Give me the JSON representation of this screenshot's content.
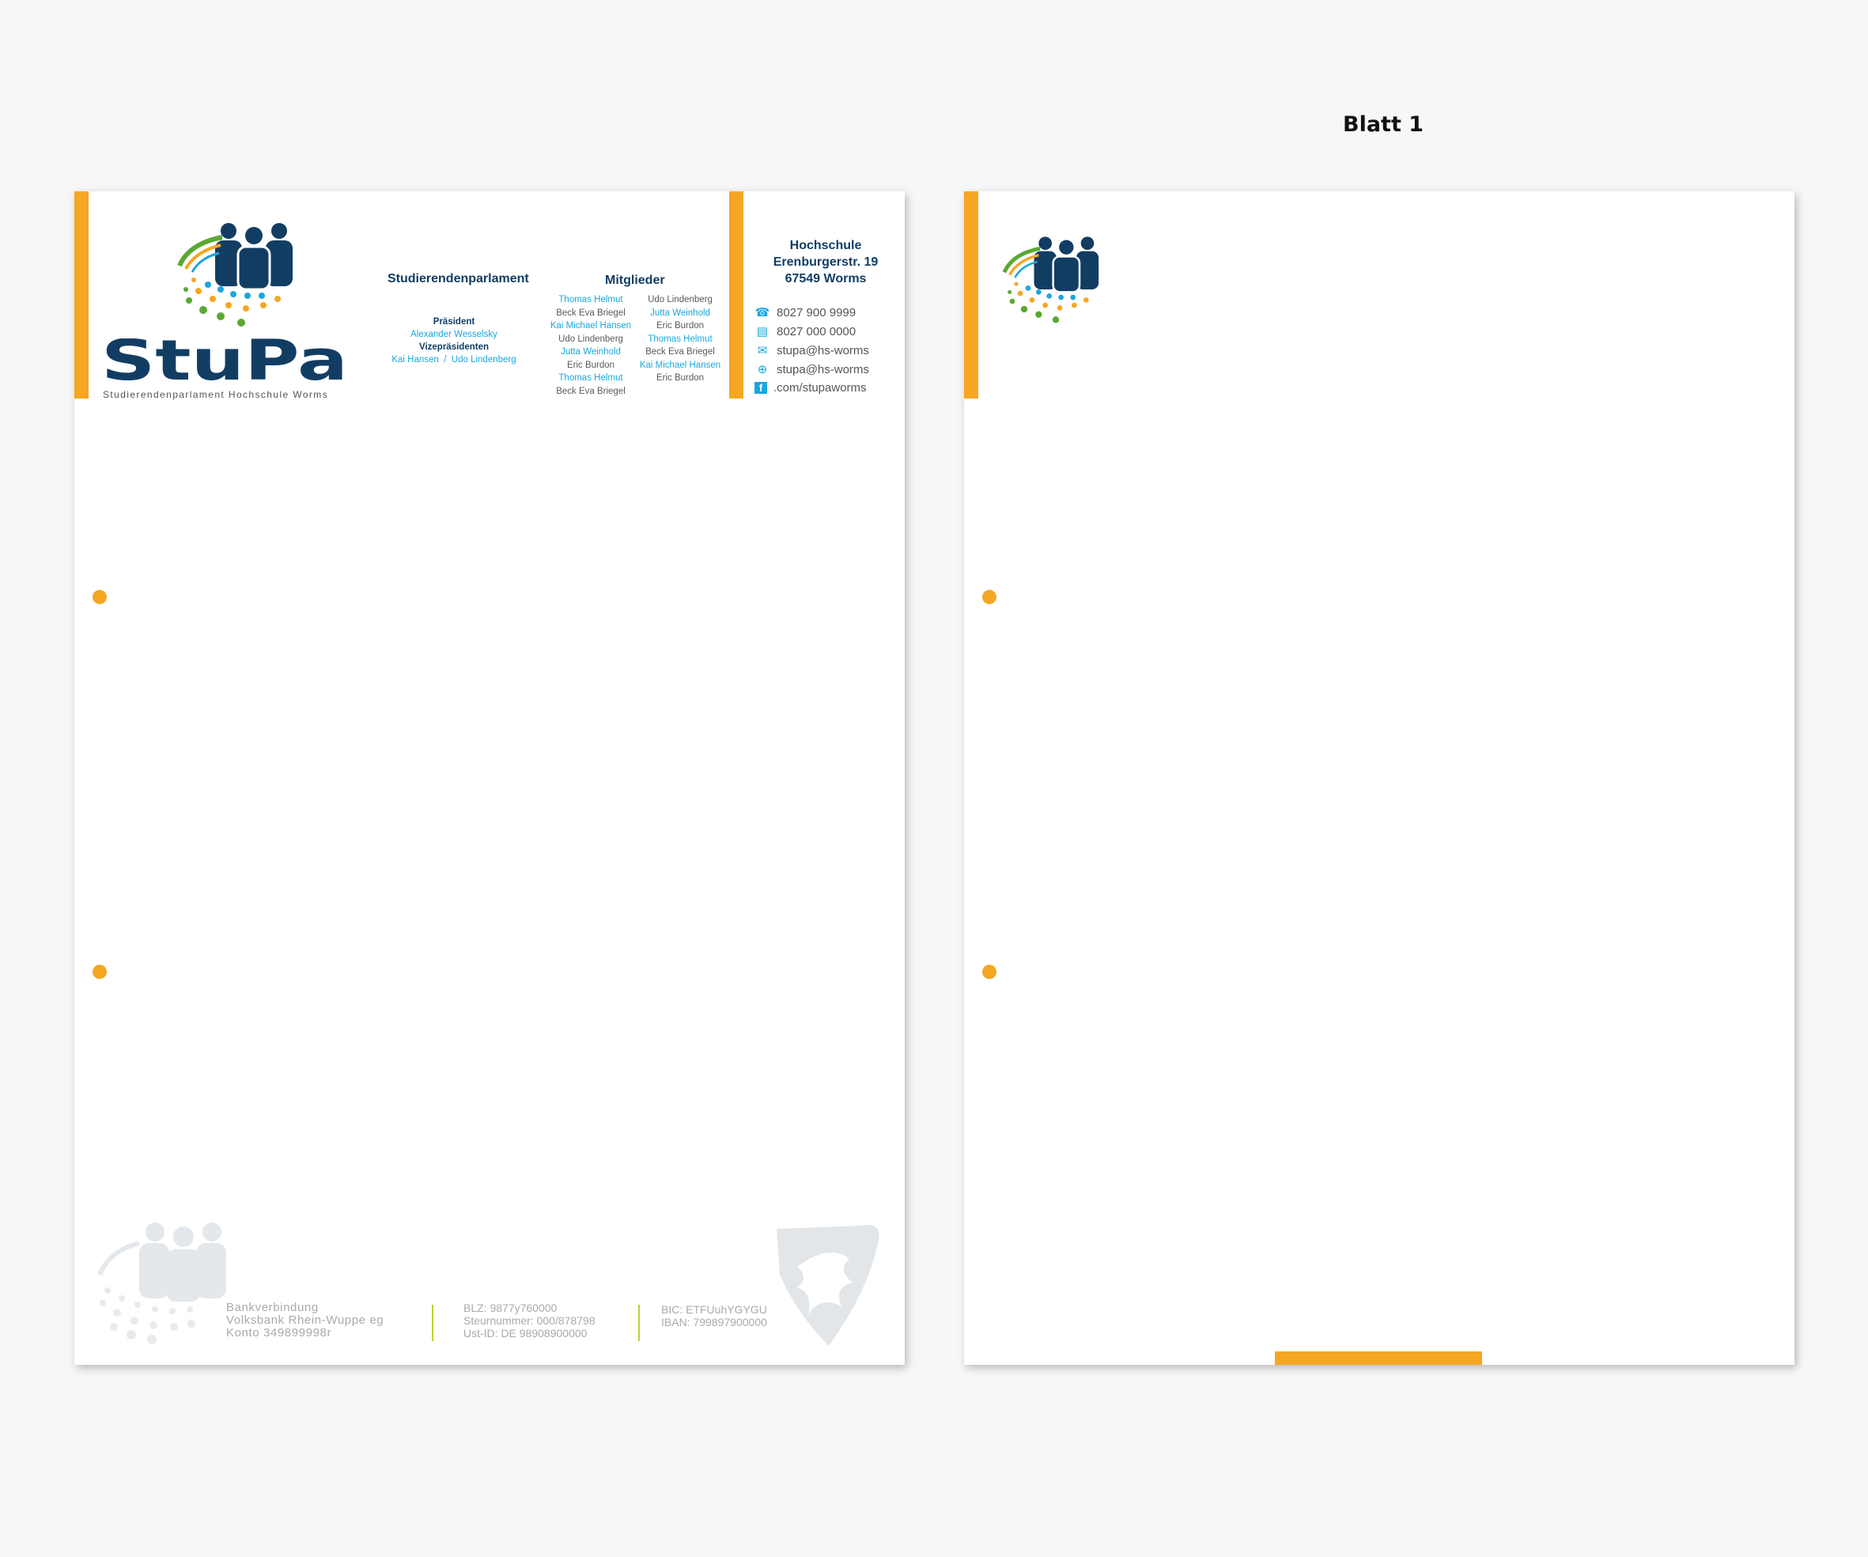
{
  "page_label": "Blatt  1",
  "letterhead": {
    "logo_word": "StuPa",
    "logo_tagline": "Studierendenparlament Hochschule Worms",
    "parliament": {
      "title": "Studierendenparlament",
      "president_label": "Präsident",
      "president_name": "Alexander Wesselsky",
      "vice_label": "Vizepräsidenten",
      "vice_names": "Kai Hansen  /  Udo Lindenberg"
    },
    "members": {
      "title": "Mitglieder",
      "left": [
        "Thomas Helmut",
        "Beck Eva Briegel",
        "Kai Michael Hansen",
        "Udo Lindenberg",
        "Jutta Weinhold",
        "Eric Burdon",
        "Thomas Helmut",
        "Beck Eva Briegel"
      ],
      "right": [
        "Udo Lindenberg",
        "Jutta Weinhold",
        "Eric Burdon",
        "Thomas Helmut",
        "Beck Eva Briegel",
        "Kai Michael Hansen",
        "Eric Burdon"
      ]
    },
    "address": {
      "line1": "Hochschule",
      "line2": "Erenburgerstr. 19",
      "line3": "67549 Worms"
    },
    "contacts": [
      {
        "icon": "phone-icon",
        "text": "8027 900 9999"
      },
      {
        "icon": "fax-icon",
        "text": "8027 000 0000"
      },
      {
        "icon": "mail-icon",
        "text": "stupa@hs-worms"
      },
      {
        "icon": "globe-icon",
        "text": "stupa@hs-worms"
      },
      {
        "icon": "facebook-icon",
        "text": ".com/stupaworms"
      }
    ]
  },
  "footer": {
    "bank_label": "Bankverbindung",
    "bank_name": "Volksbank Rhein-Wuppe eg",
    "account": "Konto 349899998r",
    "blz": "BLZ: 9877y760000",
    "tax_number": "Steurnummer: 000/878798",
    "vat_id": "Ust-ID: DE 98908900000",
    "bic": "BIC: ETFUuhYGYGU",
    "iban": "IBAN: 799897900000"
  },
  "colors": {
    "accent": "#f5a623",
    "navy": "#123d63",
    "cyan": "#1aa7dc",
    "green": "#5aa832"
  }
}
